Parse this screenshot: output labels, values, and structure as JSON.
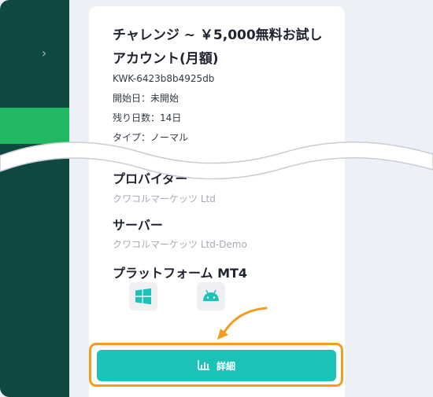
{
  "card": {
    "title": "チャレンジ ~ ￥5,000無料お試しアカウント(月額)",
    "account_id": "KWK-6423b8b4925db",
    "start_date": "開始日：未開始",
    "days_left": "残り日数：14日",
    "type": "タイプ：ノーマル"
  },
  "provider": {
    "label": "プロバイダー",
    "value": "クワコルマーケッツ Ltd"
  },
  "server": {
    "label": "サーバー",
    "value": "クワコルマーケッツ Ltd-Demo"
  },
  "platform": {
    "label": "プラットフォーム MT4",
    "icons": [
      "windows-icon",
      "android-icon"
    ]
  },
  "detail_button": {
    "label": "詳細",
    "icon": "bar-chart-icon"
  },
  "colors": {
    "sidebar": "#0e4841",
    "sidebar_active": "#20b860",
    "button": "#1cc2b8",
    "highlight": "#f39c1f"
  }
}
